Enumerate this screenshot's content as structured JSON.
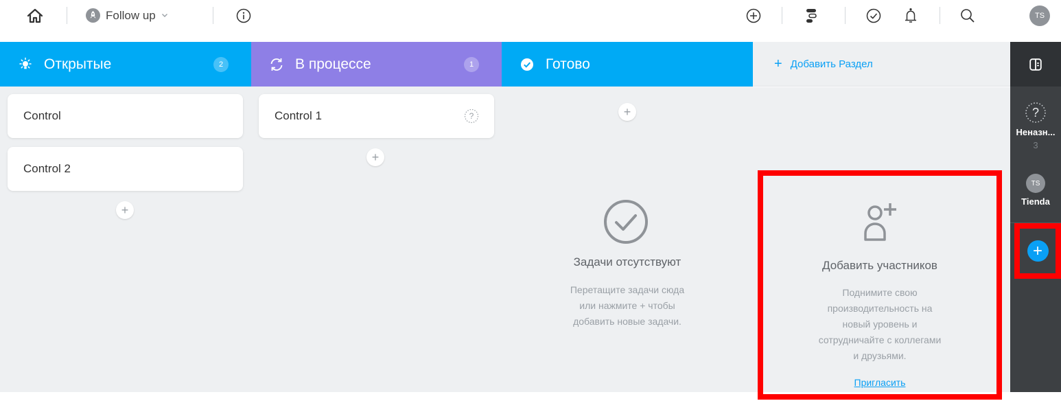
{
  "topbar": {
    "project_title": "Follow up",
    "avatar_initials": "TS",
    "icons": [
      "home-icon",
      "rocket-icon",
      "chevron-down-icon",
      "info-icon",
      "add-circle-icon",
      "timeline-icon",
      "check-circle-icon",
      "bell-icon",
      "search-icon"
    ]
  },
  "columns": [
    {
      "title": "Открытые",
      "count": "2",
      "color": "#00aaf5",
      "icon": "lightbulb-icon",
      "tasks": [
        "Control",
        "Control 2"
      ]
    },
    {
      "title": "В процессе",
      "count": "1",
      "color": "#8e7fe6",
      "icon": "refresh-icon",
      "tasks": [
        "Control 1"
      ]
    },
    {
      "title": "Готово",
      "count": "",
      "color": "#00aaf5",
      "icon": "check-circle-icon",
      "tasks": [],
      "empty_title": "Задачи отсутствуют",
      "empty_lines": [
        "Перетащите задачи сюда",
        "или нажмите + чтобы",
        "добавить новые задачи."
      ]
    }
  ],
  "add_section_label": "Добавить Раздел",
  "invite_panel": {
    "title": "Добавить участников",
    "lines": [
      "Поднимите свою",
      "производительность на",
      "новый уровень и",
      "сотрудничайте с коллегами",
      "и друзьями."
    ],
    "link": "Пригласить"
  },
  "right_sidebar": {
    "unassigned_label": "Неназн...",
    "unassigned_count": "3",
    "member_initials": "TS",
    "member_name": "Tienda"
  },
  "colors": {
    "accent": "#00aaf5",
    "in_progress": "#8e7fe6",
    "highlight": "#ff0000",
    "sidebar": "#3d4043"
  }
}
